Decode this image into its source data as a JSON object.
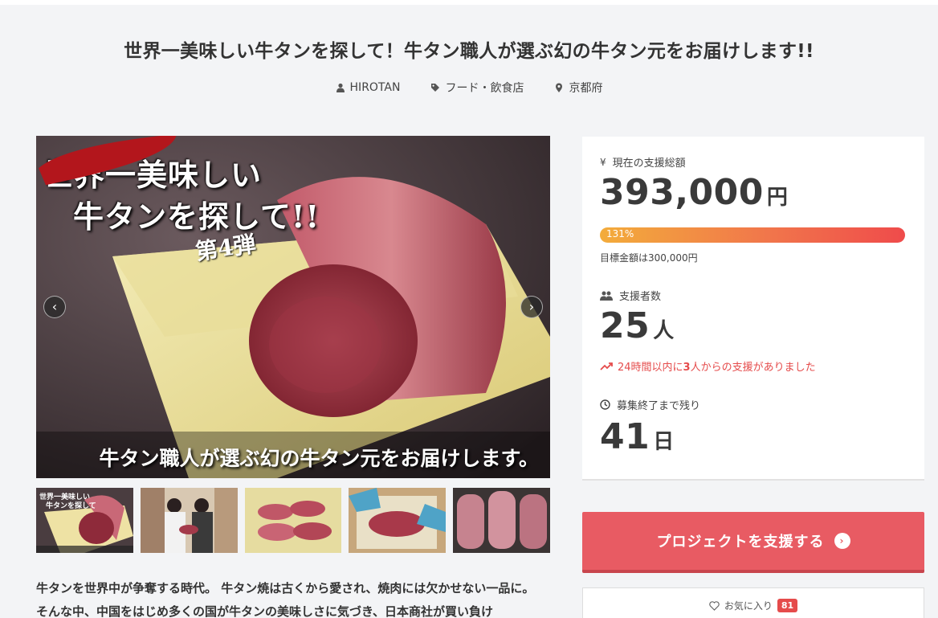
{
  "project": {
    "title": "世界一美味しい牛タンを探して！牛タン職人が選ぶ幻の牛タン元をお届けします!!",
    "owner": "HIROTAN",
    "category": "フード・飲食店",
    "location": "京都府"
  },
  "main_image": {
    "title_line1": "世界一美味しい",
    "title_line2": "牛タンを探して!!",
    "badge": "第4弾",
    "caption": "牛タン職人が選ぶ幻の牛タン元をお届けします。"
  },
  "thumbnails": [
    {
      "alt": "main-visual"
    },
    {
      "alt": "craftsmen"
    },
    {
      "alt": "sliced-tongue"
    },
    {
      "alt": "cutting-tongue"
    },
    {
      "alt": "whole-tongues"
    }
  ],
  "thumbnail1_text": {
    "line1": "世界一美味しい",
    "line2": "牛タンを探して"
  },
  "description": "牛タンを世界中が争奪する時代。 牛タン焼は古くから愛され、焼肉には欠かせない一品に。 そんな中、中国をはじめ多くの国が牛タンの美味しさに気づき、日本商社が買い負け",
  "stats": {
    "total_label": "現在の支援総額",
    "total_value": "393,000",
    "total_unit": "円",
    "progress_text": "131%",
    "progress_percent": 131,
    "goal_text": "目標金額は300,000円",
    "backers_label": "支援者数",
    "backers_value": "25",
    "backers_unit": "人",
    "recent_prefix": "24時間以内に",
    "recent_count": "3",
    "recent_suffix": "人からの支援がありました",
    "remaining_label": "募集終了まで残り",
    "remaining_value": "41",
    "remaining_unit": "日"
  },
  "actions": {
    "support_label": "プロジェクトを支援する",
    "favorite_label": "お気に入り",
    "favorite_count": "81"
  },
  "colors": {
    "accent": "#e85b63",
    "progress_start": "#f3ac3b",
    "progress_end": "#ef4b4b",
    "recent": "#e54b4b"
  },
  "icons": {
    "owner": "user-icon",
    "category": "tag-icon",
    "location": "map-pin-icon",
    "total": "yen-icon",
    "backers": "users-icon",
    "recent": "trending-up-icon",
    "remaining": "clock-icon",
    "support": "chevron-right-circle-icon",
    "favorite": "heart-icon"
  }
}
